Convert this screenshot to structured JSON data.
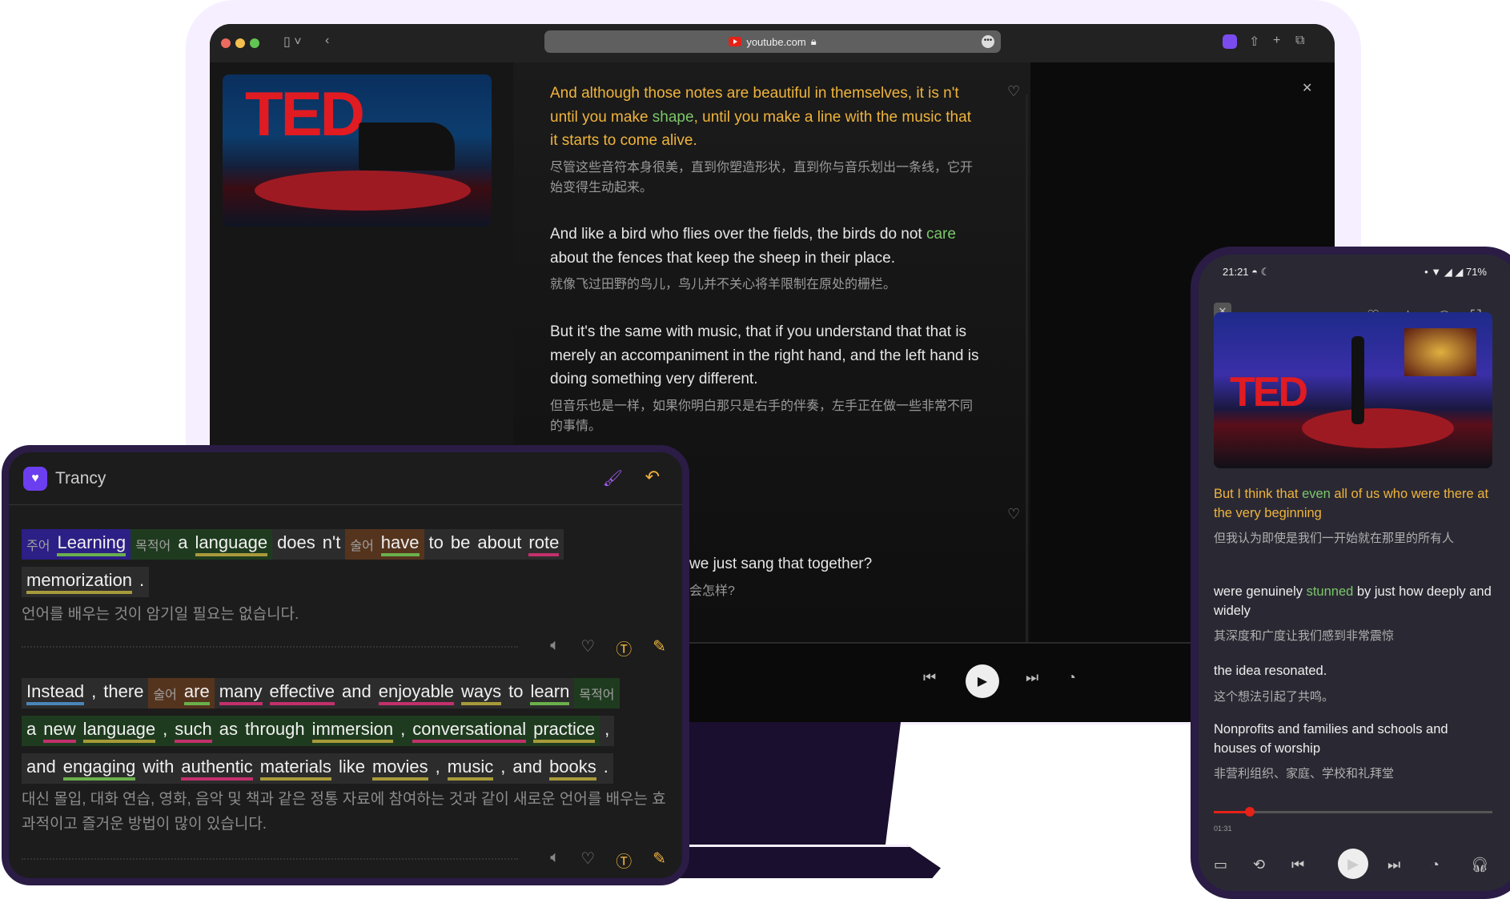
{
  "browser": {
    "url": "youtube.com",
    "traffic_colors": [
      "#ec6a5e",
      "#f4bf4f",
      "#61c554"
    ]
  },
  "desktop": {
    "video_logo": "TED",
    "subtitles": [
      {
        "pre": "And although those notes are beautiful in themselves, it is n't until you make ",
        "key": "shape",
        "post": ", until you make a line with the music that it starts to come alive.",
        "zh": "尽管这些音符本身很美，直到你塑造形状，直到你与音乐划出一条线，它开始变得生动起来。",
        "active": true
      },
      {
        "pre": "And like a bird who flies over the fields, the birds do not ",
        "key": "care",
        "post": " about the fences that keep the sheep in their place.",
        "zh": "就像飞过田野的鸟儿，鸟儿并不关心将羊限制在原处的栅栏。"
      },
      {
        "pre": "But it's the same with music, that if you understand that that is merely an accompaniment in the right hand, and the left hand is doing something very different.",
        "key": "",
        "post": "",
        "zh": "但音乐也是一样，如果你明白那只是右手的伴奏，左手正在做一些非常不同的事情。"
      },
      {
        "pre": "we just sang that together?",
        "key": "",
        "post": "",
        "zh": "会怎样?"
      }
    ]
  },
  "trancy": {
    "title": "Trancy",
    "colors": {
      "green": "#6ab04c",
      "olive": "#a89a3a",
      "pink": "#c2306c",
      "blue": "#4a86b8"
    },
    "sentences": [
      {
        "lines": [
          [
            {
              "type": "subject",
              "label": "주어",
              "words": [
                [
                  "Learning",
                  "green"
                ]
              ]
            },
            {
              "type": "object",
              "label": "목적어",
              "words": [
                [
                  "a",
                  ""
                ],
                [
                  "language",
                  "olive"
                ]
              ]
            },
            {
              "type": "plain",
              "words": [
                [
                  "does",
                  ""
                ],
                [
                  "n't",
                  ""
                ]
              ]
            },
            {
              "type": "predicate",
              "label": "술어",
              "words": [
                [
                  "have",
                  "green"
                ]
              ]
            },
            {
              "type": "plain",
              "words": [
                [
                  "to",
                  ""
                ],
                [
                  "be",
                  ""
                ],
                [
                  "about",
                  ""
                ],
                [
                  "rote",
                  "pink"
                ]
              ]
            }
          ],
          [
            {
              "type": "plain",
              "words": [
                [
                  "memorization",
                  "olive"
                ],
                [
                  ".",
                  ""
                ]
              ]
            }
          ]
        ],
        "translation": "언어를 배우는 것이 암기일 필요는 없습니다."
      },
      {
        "lines": [
          [
            {
              "type": "plain",
              "words": [
                [
                  "Instead",
                  "blue"
                ],
                [
                  ",",
                  ""
                ],
                [
                  "there",
                  ""
                ]
              ]
            },
            {
              "type": "predicate",
              "label": "술어",
              "words": [
                [
                  "are",
                  "green"
                ]
              ]
            },
            {
              "type": "plain",
              "words": [
                [
                  "many",
                  "pink"
                ],
                [
                  "effective",
                  "pink"
                ],
                [
                  "and",
                  ""
                ],
                [
                  "enjoyable",
                  "pink"
                ],
                [
                  "ways",
                  "olive"
                ],
                [
                  "to",
                  ""
                ],
                [
                  "learn",
                  "green"
                ]
              ]
            },
            {
              "type": "object",
              "label": "목적어",
              "words": []
            }
          ],
          [
            {
              "type": "object",
              "words": [
                [
                  "a",
                  ""
                ],
                [
                  "new",
                  "pink"
                ],
                [
                  "language",
                  "olive"
                ],
                [
                  ",",
                  ""
                ],
                [
                  "such",
                  "pink"
                ],
                [
                  "as",
                  ""
                ],
                [
                  "through",
                  ""
                ],
                [
                  "immersion",
                  "olive"
                ],
                [
                  ",",
                  ""
                ],
                [
                  "conversational",
                  "pink"
                ],
                [
                  "practice",
                  "olive"
                ]
              ]
            },
            {
              "type": "plain",
              "words": [
                [
                  ",",
                  ""
                ]
              ]
            }
          ],
          [
            {
              "type": "plain",
              "words": [
                [
                  "and",
                  ""
                ],
                [
                  "engaging",
                  "green"
                ],
                [
                  "with",
                  ""
                ],
                [
                  "authentic",
                  "pink"
                ],
                [
                  "materials",
                  "olive"
                ],
                [
                  "like",
                  ""
                ],
                [
                  "movies",
                  "olive"
                ],
                [
                  ",",
                  ""
                ],
                [
                  "music",
                  "olive"
                ],
                [
                  ",",
                  ""
                ],
                [
                  "and",
                  ""
                ],
                [
                  "books",
                  "olive"
                ],
                [
                  ".",
                  ""
                ]
              ]
            }
          ]
        ],
        "translation": "대신 몰입, 대화 연습, 영화, 음악 및 책과 같은 정통 자료에 참여하는 것과 같이 새로운 언어를 배우는 효과적이고 즐거운 방법이 많이 있습니다."
      }
    ]
  },
  "phone": {
    "time": "21:21",
    "battery": "71%",
    "video_logo": "TED",
    "subtitles": [
      {
        "pre": "But I think that ",
        "key": "even",
        "post": " all of us who were there at the very beginning",
        "zh": "但我认为即使是我们一开始就在那里的所有人",
        "active": true
      },
      {
        "pre": "were genuinely ",
        "key": "stunned",
        "post": " by just how deeply and widely",
        "zh": "其深度和广度让我们感到非常震惊"
      },
      {
        "pre": "the idea resonated.",
        "key": "",
        "post": "",
        "zh": "这个想法引起了共鸣。"
      },
      {
        "pre": "Nonprofits and families and schools and houses of worship",
        "key": "",
        "post": "",
        "zh": "非营利组织、家庭、学校和礼拜堂"
      }
    ],
    "elapsed": "01:31",
    "progress": 0.13
  }
}
